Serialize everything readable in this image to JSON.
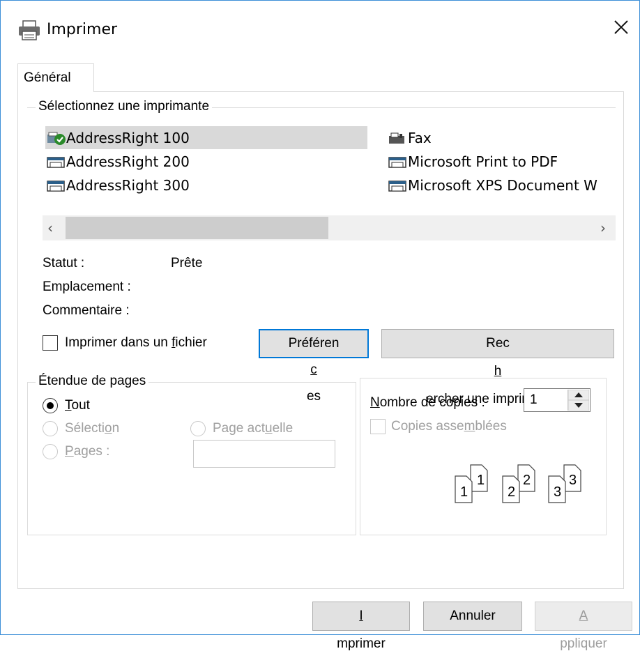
{
  "window": {
    "title": "Imprimer",
    "icon": "printer-icon"
  },
  "tabs": [
    {
      "label": "Général"
    }
  ],
  "printer_group": {
    "legend": "Sélectionnez une imprimante",
    "printers": [
      {
        "name": "AddressRight 100",
        "icon": "printer-default-icon",
        "selected": true
      },
      {
        "name": "AddressRight 200",
        "icon": "printer-icon"
      },
      {
        "name": "AddressRight 300",
        "icon": "printer-icon"
      },
      {
        "name": "Fax",
        "icon": "fax-icon"
      },
      {
        "name": "Microsoft Print to PDF",
        "icon": "printer-icon"
      },
      {
        "name": "Microsoft XPS Document W",
        "icon": "printer-icon"
      }
    ],
    "status_label": "Statut :",
    "status_value": "Prête",
    "location_label": "Emplacement :",
    "comment_label": "Commentaire :",
    "print_to_file_pre": "Imprimer dans un ",
    "print_to_file_u": "f",
    "print_to_file_post": "ichier",
    "preferences_pre": "Préféren",
    "preferences_u": "c",
    "preferences_post": "es",
    "find_printer_pre": "Rec",
    "find_printer_u": "h",
    "find_printer_post": "ercher une imprimante..."
  },
  "range_group": {
    "legend": "Étendue de pages",
    "all_u": "T",
    "all_post": "out",
    "selection_pre": "Sélecti",
    "selection_u": "o",
    "selection_post": "n",
    "current_pre": "Page act",
    "current_u": "u",
    "current_post": "elle",
    "pages_u": "P",
    "pages_post": "ages :"
  },
  "copies_group": {
    "count_u": "N",
    "count_post": "ombre de copies :",
    "count_value": "1",
    "collate_pre": "Copies asse",
    "collate_u": "m",
    "collate_post": "blées",
    "collate_pages": [
      "1",
      "1",
      "2",
      "2",
      "3",
      "3"
    ]
  },
  "buttons": {
    "print_u": "I",
    "print_post": "mprimer",
    "cancel": "Annuler",
    "apply_u": "A",
    "apply_post": "ppliquer"
  },
  "colors": {
    "accent": "#0078d7",
    "selection": "#d9d9d9",
    "window_border": "#3c8fd8",
    "disabled_text": "#a0a0a0"
  }
}
